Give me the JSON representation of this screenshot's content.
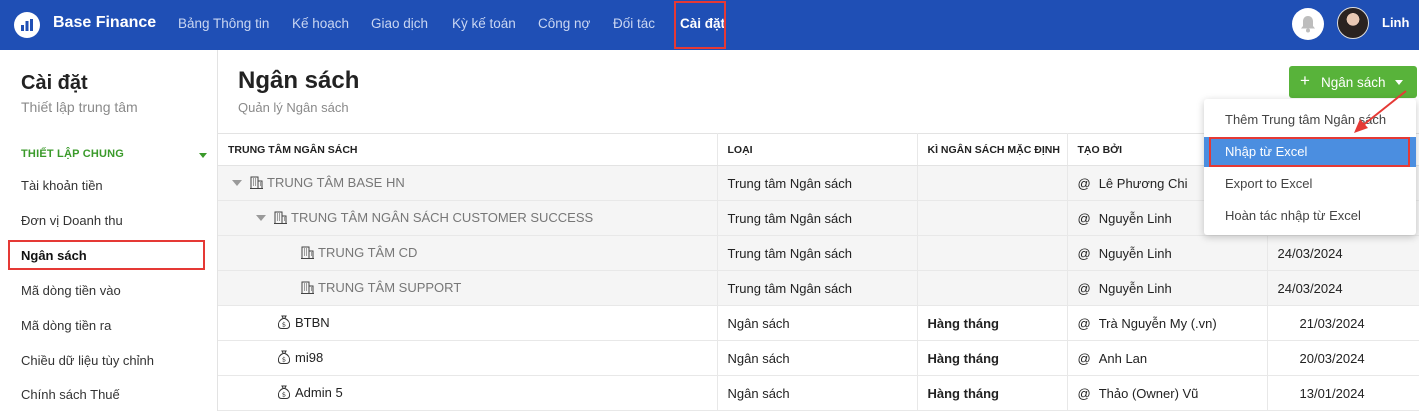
{
  "app": {
    "name": "Base Finance",
    "user": "Linh"
  },
  "nav": [
    "Bảng Thông tin",
    "Kế hoạch",
    "Giao dịch",
    "Kỳ kế toán",
    "Công nợ",
    "Đối tác",
    "Cài đặt"
  ],
  "nav_active": "Cài đặt",
  "sidebar": {
    "title": "Cài đặt",
    "subtitle": "Thiết lập trung tâm",
    "group": "THIẾT LẬP CHUNG",
    "items": [
      "Tài khoản tiền",
      "Đơn vị Doanh thu",
      "Ngân sách",
      "Mã dòng tiền vào",
      "Mã dòng tiền ra",
      "Chiều dữ liệu tùy chỉnh",
      "Chính sách Thuế"
    ],
    "active": "Ngân sách"
  },
  "page": {
    "title": "Ngân sách",
    "subtitle": "Quản lý Ngân sách",
    "add_button": "Ngân sách"
  },
  "table": {
    "headers": [
      "TRUNG TÂM NGÂN SÁCH",
      "LOẠI",
      "KÌ NGÂN SÁCH MẶC ĐỊNH",
      "TẠO BỞI",
      ""
    ],
    "rows": [
      {
        "name": "TRUNG TÂM BASE HN",
        "type": "Trung tâm Ngân sách",
        "period": "",
        "creator": "Lê Phương Chi",
        "date": ""
      },
      {
        "name": "TRUNG TÂM NGÂN SÁCH CUSTOMER SUCCESS",
        "type": "Trung tâm Ngân sách",
        "period": "",
        "creator": "Nguyễn Linh",
        "date": ""
      },
      {
        "name": "TRUNG TÂM CD",
        "type": "Trung tâm Ngân sách",
        "period": "",
        "creator": "Nguyễn Linh",
        "date": "24/03/2024"
      },
      {
        "name": "TRUNG TÂM SUPPORT",
        "type": "Trung tâm Ngân sách",
        "period": "",
        "creator": "Nguyễn Linh",
        "date": "24/03/2024"
      },
      {
        "name": "BTBN",
        "type": "Ngân sách",
        "period": "Hàng tháng",
        "creator": "Trà Nguyễn My (.vn)",
        "date": "21/03/2024"
      },
      {
        "name": "mi98",
        "type": "Ngân sách",
        "period": "Hàng tháng",
        "creator": "Anh Lan",
        "date": "20/03/2024"
      },
      {
        "name": "Admin 5",
        "type": "Ngân sách",
        "period": "Hàng tháng",
        "creator": "Thảo (Owner) Vũ",
        "date": "13/01/2024"
      }
    ]
  },
  "dropdown": {
    "items": [
      "Thêm Trung tâm Ngân sách",
      "Nhập từ Excel",
      "Export to Excel",
      "Hoàn tác nhập từ Excel"
    ],
    "selected": "Nhập từ Excel"
  },
  "colors": {
    "topbar": "#1f4fb5",
    "accent_green": "#58b33a",
    "highlight_red": "#e53935",
    "dropdown_selected": "#4b8ee0"
  },
  "icons": {
    "logo": "chart-logo-icon",
    "bell": "bell-icon",
    "center": "building-icon",
    "budget": "money-bag-icon",
    "creator": "at-icon"
  }
}
